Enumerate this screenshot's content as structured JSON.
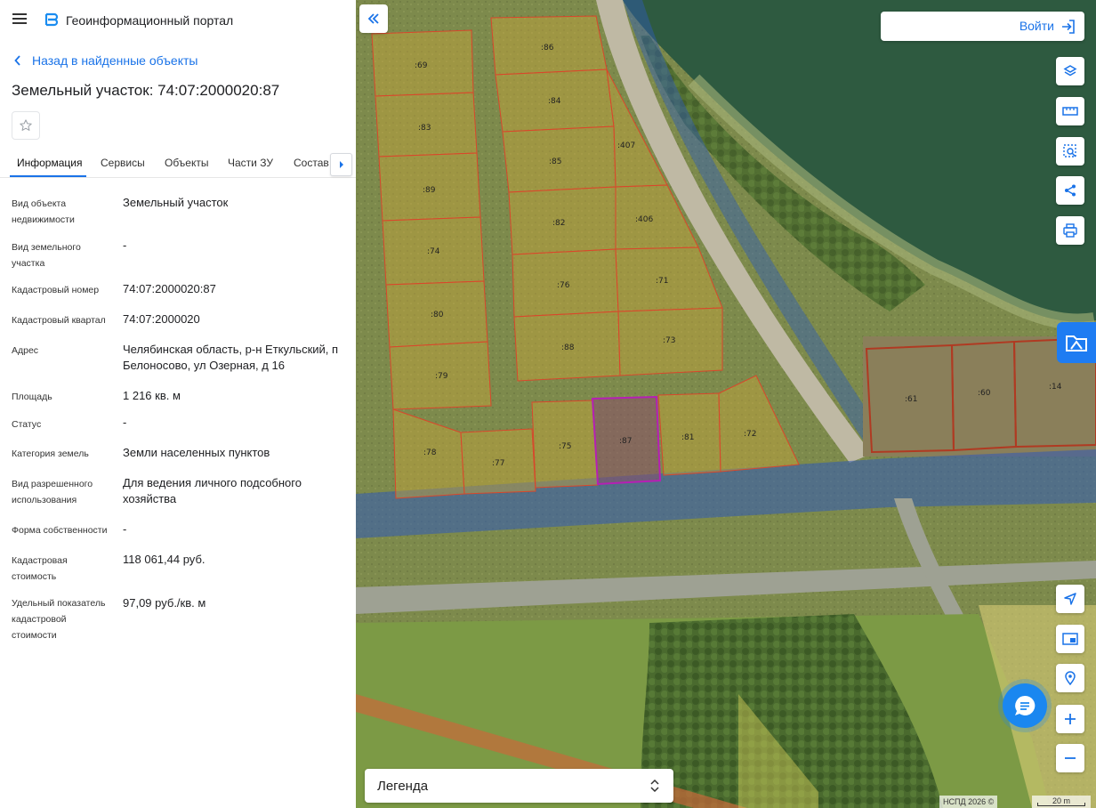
{
  "app": {
    "title": "Геоинформационный портал"
  },
  "nav": {
    "back_label": "Назад в найденные объекты"
  },
  "object": {
    "title": "Земельный участок: 74:07:2000020:87"
  },
  "tabs": [
    {
      "label": "Информация",
      "active": true
    },
    {
      "label": "Сервисы"
    },
    {
      "label": "Объекты"
    },
    {
      "label": "Части ЗУ"
    },
    {
      "label": "Состав"
    }
  ],
  "info": [
    {
      "label": "Вид объекта недвижимости",
      "value": "Земельный участок"
    },
    {
      "label": "Вид земельного участка",
      "value": "-"
    },
    {
      "label": "Кадастровый номер",
      "value": "74:07:2000020:87"
    },
    {
      "label": "Кадастровый квартал",
      "value": "74:07:2000020"
    },
    {
      "label": "Адрес",
      "value": "Челябинская область, р-н Еткульский, п Белоносово, ул Озерная, д 16"
    },
    {
      "label": "Площадь",
      "value": "1 216 кв. м"
    },
    {
      "label": "Статус",
      "value": "-"
    },
    {
      "label": "Категория земель",
      "value": "Земли населенных пунктов"
    },
    {
      "label": "Вид разрешенного использования",
      "value": "Для ведения личного подсобного хозяйства"
    },
    {
      "label": "Форма собственности",
      "value": "-"
    },
    {
      "label": "Кадастровая стоимость",
      "value": "118 061,44 руб."
    },
    {
      "label": "Удельный показатель кадастровой стоимости",
      "value": "97,09 руб./кв. м"
    }
  ],
  "map": {
    "login_label": "Войти",
    "legend_label": "Легенда",
    "attribution": "НСПД 2026 ©",
    "scale_label": "20 m",
    "parcels": [
      ":69",
      ":86",
      ":84",
      ":83",
      ":407",
      ":85",
      ":89",
      ":82",
      ":406",
      ":74",
      ":76",
      ":71",
      ":80",
      ":88",
      ":73",
      ":79",
      ":61",
      ":60",
      ":14",
      ":78",
      ":77",
      ":75",
      ":87",
      ":81",
      ":72"
    ],
    "selected_parcel": ":87",
    "colors": {
      "accent": "#1a73e8",
      "parcel_border": "#d9472b",
      "selected_border": "#b61fb5",
      "parcel_fill": "#c8a53a"
    }
  }
}
